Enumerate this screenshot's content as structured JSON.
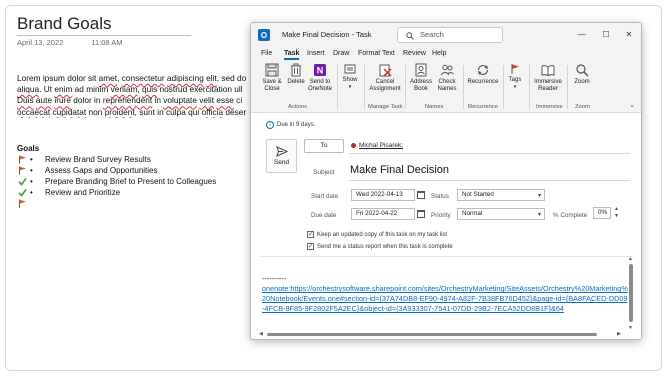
{
  "onenote": {
    "title": "Brand Goals",
    "date": "April 13, 2022",
    "time": "11:08 AM",
    "paragraph_lines": [
      [
        "Lorem ipsum dolor sit ",
        "amet",
        ", ",
        "consectetur",
        " ",
        "adipiscing",
        " ",
        "elit",
        ", sed do"
      ],
      [
        "aliqua",
        ". Ut ",
        "enim",
        " ad minim ",
        "veniam",
        ", ",
        "quis",
        " nostrud exercitation ull"
      ],
      [
        "Duis",
        " ",
        "aute",
        " ",
        "irure",
        " dolor in ",
        "reprehenderit",
        " in ",
        "voluptate",
        " ",
        "velit",
        " ",
        "esse",
        " ci"
      ],
      [
        "occaecat",
        " ",
        "cupidatat",
        " non ",
        "proident",
        ", sunt in culpa qui ",
        "officia",
        " ",
        "deser"
      ]
    ],
    "goals_title": "Goals",
    "goals": [
      {
        "text": "Review Brand Survey Results",
        "tag": "flag"
      },
      {
        "text": "Assess Gaps and Opportunities",
        "tag": "flag"
      },
      {
        "text": "Prepare Branding Brief to Present to Colleagues",
        "tag": "check"
      },
      {
        "text": "Review and Prioritize",
        "tag": "check"
      },
      {
        "text": "",
        "tag": "flag"
      }
    ]
  },
  "outlook": {
    "window_title": "Make Final Decision  -  Task",
    "search_placeholder": "Search",
    "window_controls": [
      "—",
      "☐",
      "✕"
    ],
    "menu": [
      "File",
      "Task",
      "Insert",
      "Draw",
      "Format Text",
      "Review",
      "Help"
    ],
    "active_menu": "Task",
    "ribbon": {
      "save_close": "Save &\nClose",
      "delete": "Delete",
      "send_onenote": "Send to\nOneNote",
      "show": "Show",
      "cancel_assignment": "Cancel\nAssignment",
      "address_book": "Address\nBook",
      "check_names": "Check\nNames",
      "recurrence": "Recurrence",
      "tags": "Tags",
      "immersive_reader": "Immersive\nReader",
      "zoom": "Zoom",
      "groups": {
        "actions": "Actions",
        "manage_task": "Manage Task",
        "names": "Names",
        "recurrence": "Recurrence",
        "immersive": "Immersive",
        "zoom": "Zoom"
      }
    },
    "info_text": "Due in 9 days.",
    "send_label": "Send",
    "to_label": "To",
    "recipient": "Michal Pisarek;",
    "subject_label": "Subject",
    "subject": "Make Final Decision",
    "start_date_label": "Start date",
    "start_date": "Wed 2022-04-13",
    "due_date_label": "Due date",
    "due_date": "Fri 2022-04-22",
    "status_label": "Status",
    "status": "Not Started",
    "priority_label": "Priority",
    "priority": "Normal",
    "complete_label": "% Complete",
    "complete": "0%",
    "checkbox_keep_copy": "Keep an updated copy of this task on my task list",
    "checkbox_status_report": "Send me a status report when this task is complete",
    "notes_divider": "----------",
    "notes_link": "onenote:https://orchestrysoftware.sharepoint.com/sites/OrchestryMarketing/SiteAssets/Orchestry%20Marketing%20Notebook/Events.one#section-id={37A74DB8-EF90-4974-A82F-7B38FB76D452}&page-id={BA8FACED-DD09-4FCB-8F85-9F2802F5A2EC}&object-id={3A933307-7541-07DD-29B2-7ECA52DD8B1F}&64"
  },
  "colors": {
    "accent": "#0f6cbd",
    "flag": "#e3552b",
    "check": "#3c9a3c",
    "onenote_purple": "#7719aa",
    "recipient_dot": "#c4262e"
  }
}
